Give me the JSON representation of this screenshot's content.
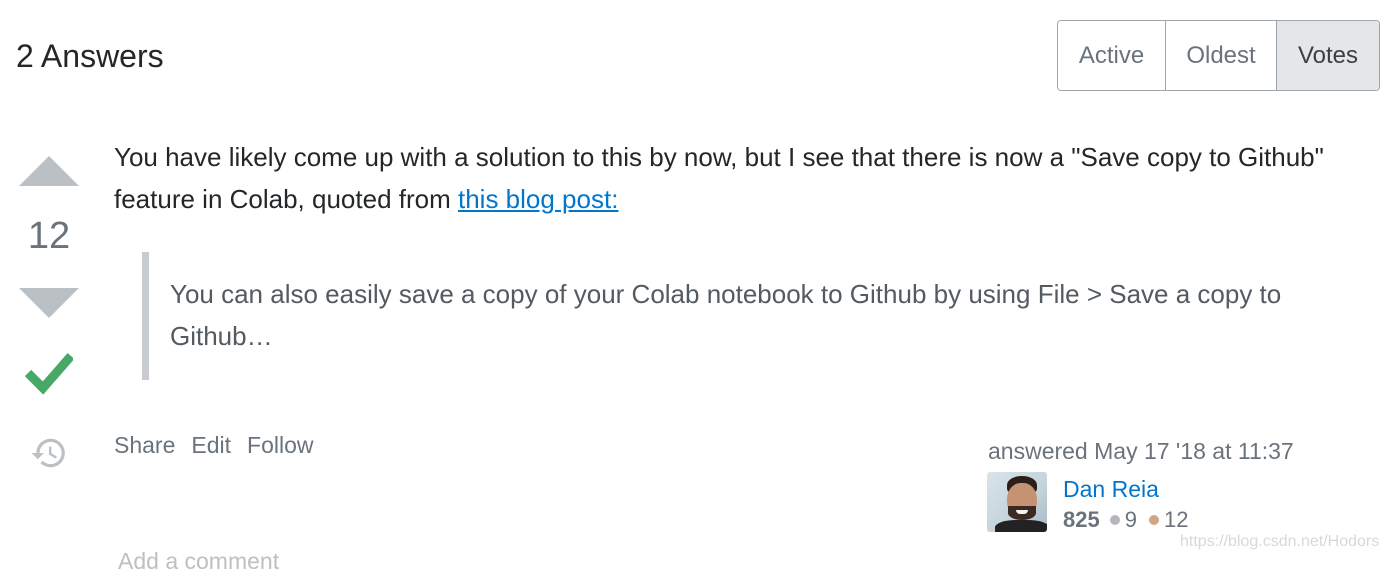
{
  "header": {
    "title": "2 Answers"
  },
  "sort_tabs": [
    {
      "label": "Active",
      "selected": false
    },
    {
      "label": "Oldest",
      "selected": false
    },
    {
      "label": "Votes",
      "selected": true
    }
  ],
  "answer": {
    "vote_count": "12",
    "accepted": true,
    "body_text": "You have likely come up with a solution to this by now, but I see that there is now a \"Save copy to Github\" feature in Colab, quoted from ",
    "link_text": "this blog post:",
    "quote": "You can also easily save a copy of your Colab notebook to Github by using File > Save a copy to Github…",
    "menu": {
      "share": "Share",
      "edit": "Edit",
      "follow": "Follow"
    },
    "user_action": "answered May 17 '18 at 11:37",
    "user": {
      "name": "Dan Reia",
      "reputation": "825",
      "silver_badges": "9",
      "bronze_badges": "12"
    },
    "add_comment": "Add a comment"
  },
  "watermark": "https://blog.csdn.net/Hodors",
  "colors": {
    "link": "#0077cc",
    "accepted": "#48a868",
    "vote_arrow": "#bbc0c4",
    "quote_border": "#c8ccd0",
    "silver_badge": "#b4b8bc",
    "bronze_badge": "#d1a684"
  },
  "icons": {
    "vote_up": "arrow-up-icon",
    "vote_down": "arrow-down-icon",
    "accepted": "checkmark-icon",
    "history": "history-icon"
  }
}
